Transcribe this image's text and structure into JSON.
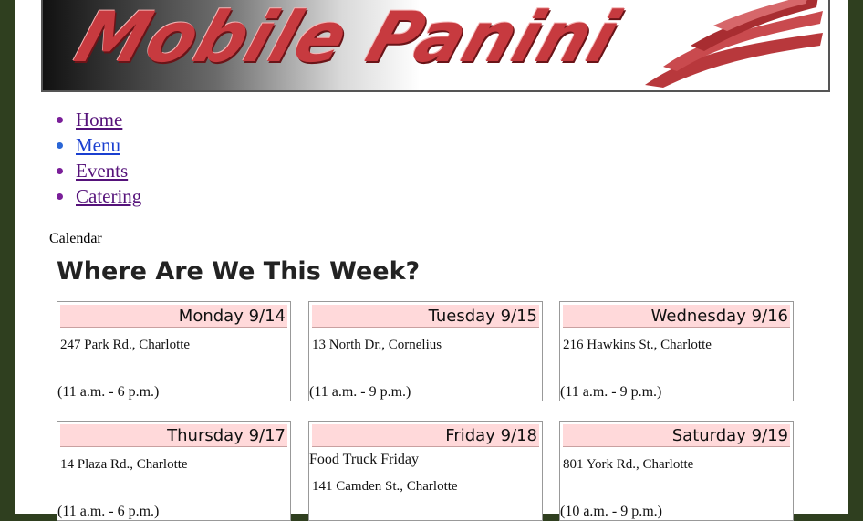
{
  "banner": {
    "title": "Mobile Panini"
  },
  "nav": [
    {
      "label": "Home"
    },
    {
      "label": "Menu"
    },
    {
      "label": "Events"
    },
    {
      "label": "Catering"
    }
  ],
  "calendar_label": "Calendar",
  "week_heading": "Where Are We This Week?",
  "days": [
    {
      "day": "Monday 9/14",
      "address": "247 Park Rd., Charlotte",
      "hours": "(11 a.m. - 6 p.m.)"
    },
    {
      "day": "Tuesday 9/15",
      "address": "13 North Dr., Cornelius",
      "hours": "(11 a.m. - 9 p.m.)"
    },
    {
      "day": "Wednesday 9/16",
      "address": "216 Hawkins St., Charlotte",
      "hours": "(11 a.m. - 9 p.m.)"
    },
    {
      "day": "Thursday 9/17",
      "address": "14 Plaza Rd., Charlotte",
      "hours": "(11 a.m. - 6 p.m.)"
    },
    {
      "day": "Friday 9/18",
      "note": "Food Truck Friday",
      "address": "141 Camden St., Charlotte"
    },
    {
      "day": "Saturday 9/19",
      "address": "801 York Rd., Charlotte",
      "hours": "(10 a.m. - 9 p.m.)"
    }
  ]
}
